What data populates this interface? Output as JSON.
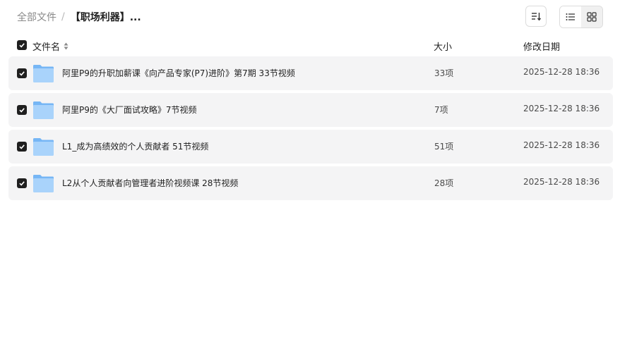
{
  "breadcrumb": {
    "root": "全部文件",
    "separator": "/",
    "current": "【职场利器】..."
  },
  "toolbar": {
    "sort_icon": "sort-icon",
    "list_view_icon": "list-view-icon",
    "grid_view_icon": "grid-view-icon"
  },
  "table": {
    "headers": {
      "name": "文件名",
      "size": "大小",
      "date": "修改日期"
    },
    "select_all_checked": true,
    "rows": [
      {
        "name": "阿里P9的升职加薪课《向产品专家(P7)进阶》第7期 33节视频",
        "size": "33项",
        "date": "2025-12-28 18:36",
        "checked": true,
        "icon": "folder-icon"
      },
      {
        "name": "阿里P9的《大厂面试攻略》7节视频",
        "size": "7项",
        "date": "2025-12-28 18:36",
        "checked": true,
        "icon": "folder-icon"
      },
      {
        "name": "L1_成为高绩效的个人贡献者 51节视频",
        "size": "51项",
        "date": "2025-12-28 18:36",
        "checked": true,
        "icon": "folder-icon"
      },
      {
        "name": "L2从个人贡献者向管理者进阶视频课 28节视频",
        "size": "28项",
        "date": "2025-12-28 18:36",
        "checked": true,
        "icon": "folder-icon"
      }
    ]
  },
  "colors": {
    "row_background": "#f4f4f5",
    "checkbox": "#1f1f1f",
    "folder_light": "#a9d3fb",
    "folder_dark": "#76b6f5"
  }
}
